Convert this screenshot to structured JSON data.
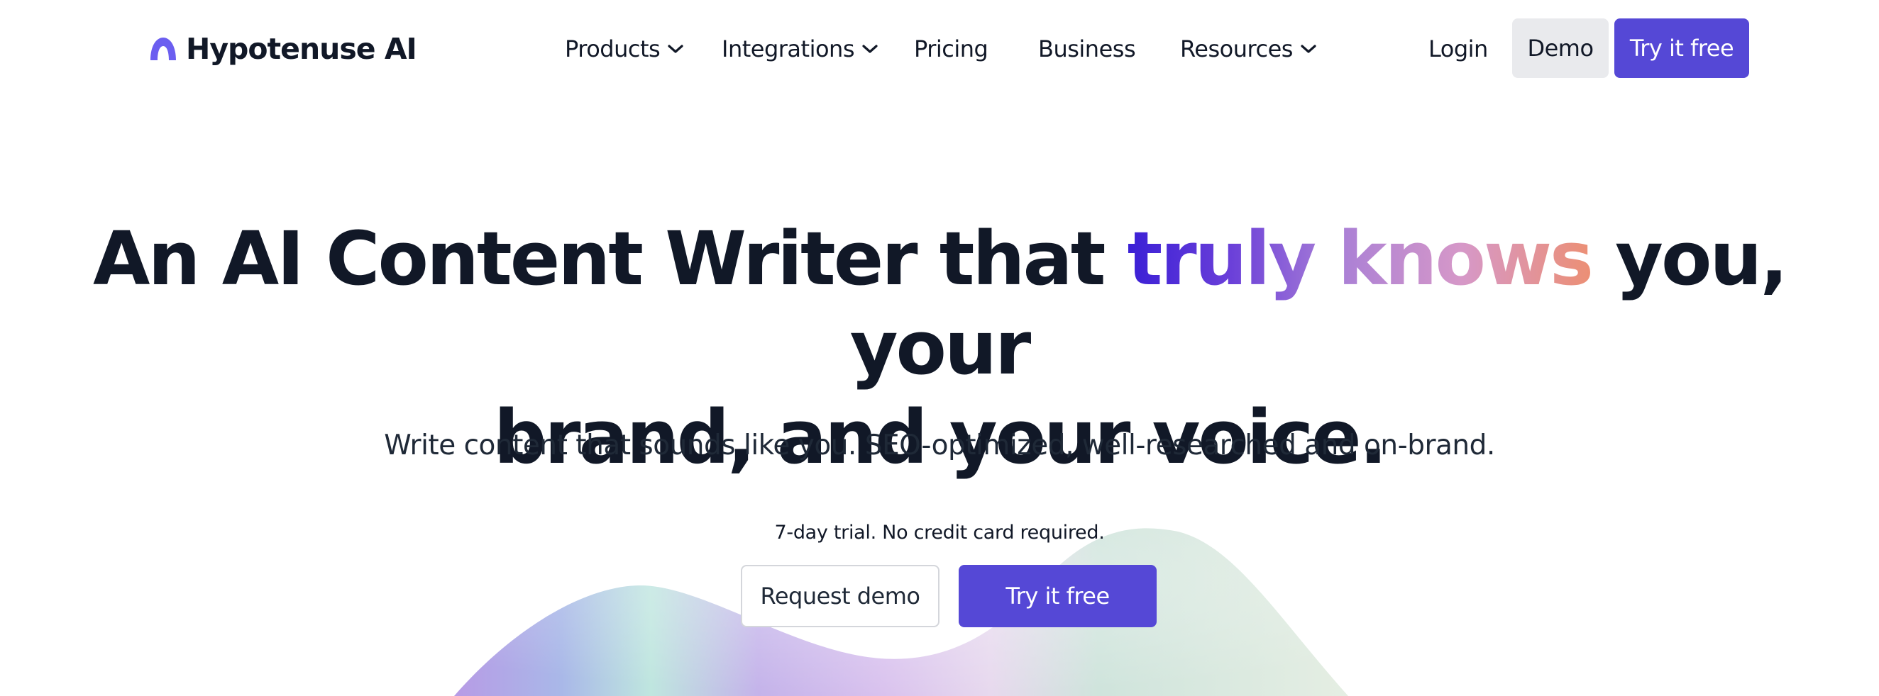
{
  "brand": {
    "name": "Hypotenuse AI",
    "logo_icon": "hypotenuse-arch-logo",
    "logo_color": "#6b5ef0"
  },
  "nav": {
    "items": [
      {
        "label": "Products",
        "icon": "chevron-down-icon"
      },
      {
        "label": "Integrations",
        "icon": "chevron-down-icon"
      },
      {
        "label": "Pricing"
      },
      {
        "label": "Business"
      },
      {
        "label": "Resources",
        "icon": "chevron-down-icon"
      }
    ],
    "login_label": "Login",
    "demo_label": "Demo",
    "try_label": "Try it free"
  },
  "hero": {
    "headline_part1": "An AI Content Writer that ",
    "headline_highlight": "truly knows",
    "headline_part2": " you, your",
    "headline_line2": "brand, and your voice.",
    "subheadline": "Write content that sounds like you. SEO-optimized, well-researched and on-brand.",
    "trial_note": "7-day trial. No credit card required.",
    "request_demo_label": "Request demo",
    "try_label": "Try it free"
  },
  "colors": {
    "accent": "#5548d6",
    "text": "#111827",
    "demo_button_bg": "#e9eaed",
    "highlight_gradient": [
      "#3a1fd6",
      "#a97fd6",
      "#d698c8",
      "#ec8f74"
    ]
  }
}
